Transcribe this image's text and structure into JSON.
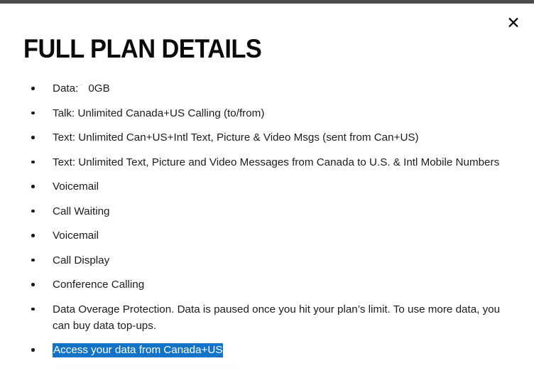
{
  "modal": {
    "title": "FULL PLAN DETAILS",
    "close_label": "✕",
    "close_name": "close-icon"
  },
  "colors": {
    "top_strip": "#4d4d4d",
    "background": "#ffffff",
    "text": "#1c1c1c",
    "title": "#0a0a0a",
    "selection_background": "#1273c9",
    "selection_text": "#ffffff"
  },
  "features": [
    {
      "id": "data",
      "prefix": "Data:",
      "clipped": "1",
      "suffix": "0GB",
      "text": "Data:  0GB",
      "selected": false,
      "has_clipped_glyph": true
    },
    {
      "id": "talk",
      "text": "Talk: Unlimited Canada+US Calling (to/from)",
      "selected": false,
      "has_clipped_glyph": false
    },
    {
      "id": "text-intl",
      "text": "Text: Unlimited Can+US+Intl Text, Picture & Video Msgs (sent from Can+US)",
      "selected": false,
      "has_clipped_glyph": false
    },
    {
      "id": "text-messages",
      "text": "Text: Unlimited Text, Picture and Video Messages from Canada to U.S. & Intl Mobile Numbers",
      "selected": false,
      "has_clipped_glyph": false
    },
    {
      "id": "voicemail-1",
      "text": "Voicemail",
      "selected": false,
      "has_clipped_glyph": false
    },
    {
      "id": "call-waiting",
      "text": "Call Waiting",
      "selected": false,
      "has_clipped_glyph": false
    },
    {
      "id": "voicemail-2",
      "text": "Voicemail",
      "selected": false,
      "has_clipped_glyph": false
    },
    {
      "id": "call-display",
      "text": "Call Display",
      "selected": false,
      "has_clipped_glyph": false
    },
    {
      "id": "conference-calling",
      "text": "Conference Calling",
      "selected": false,
      "has_clipped_glyph": false
    },
    {
      "id": "data-overage-protection",
      "text": "Data Overage Protection. Data is paused once you hit your plan’s limit. To use more data, you can buy data top-ups.",
      "selected": false,
      "has_clipped_glyph": false
    },
    {
      "id": "access-data-canada-us",
      "text": "Access your data from Canada+US",
      "selected": true,
      "has_clipped_glyph": false
    }
  ]
}
